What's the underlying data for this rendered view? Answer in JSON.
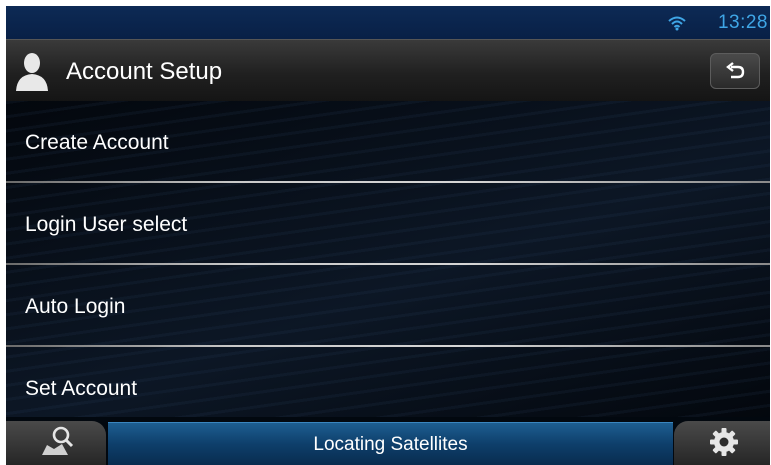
{
  "status_bar": {
    "clock": "13:28",
    "wifi_icon": "wifi-icon",
    "clock_color": "#3fa6e6"
  },
  "header": {
    "title": "Account Setup",
    "user_icon": "person-icon",
    "back_icon": "back-arrow-icon"
  },
  "menu": {
    "items": [
      {
        "label": "Create Account"
      },
      {
        "label": "Login User select"
      },
      {
        "label": "Auto Login"
      },
      {
        "label": "Set Account"
      }
    ]
  },
  "bottom_bar": {
    "status_text": "Locating Satellites",
    "left_icon": "map-search-icon",
    "right_icon": "gear-icon",
    "accent_color": "#1d5e91"
  }
}
